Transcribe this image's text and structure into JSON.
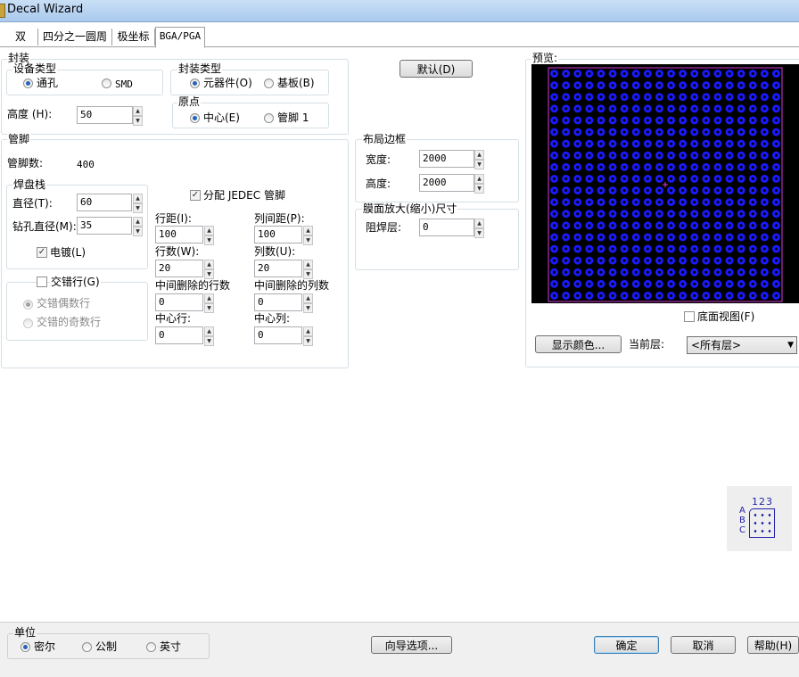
{
  "window": {
    "title": "Decal Wizard"
  },
  "tabs": [
    {
      "label": "双"
    },
    {
      "label": "四分之一圆周"
    },
    {
      "label": "极坐标"
    },
    {
      "label": "BGA/PGA",
      "active": true
    }
  ],
  "package": {
    "group_label": "封装",
    "device_type": {
      "label": "设备类型",
      "options": [
        "通孔",
        "SMD"
      ],
      "selected": "通孔"
    },
    "package_type": {
      "label": "封装类型",
      "options": [
        "元器件(O)",
        "基板(B)"
      ],
      "selected": "元器件(O)"
    },
    "height": {
      "label": "高度 (H):",
      "value": "50"
    },
    "origin": {
      "label": "原点",
      "options": [
        "中心(E)",
        "管脚 1"
      ],
      "selected": "中心(E)"
    },
    "default_button": "默认(D)"
  },
  "pins": {
    "group_label": "管脚",
    "count_label": "管脚数:",
    "count_value": "400",
    "padstack": {
      "label": "焊盘栈",
      "diameter_label": "直径(T):",
      "diameter_value": "60",
      "drill_label": "钻孔直径(M):",
      "drill_value": "35",
      "plated_label": "电镀(L)",
      "plated_checked": true
    },
    "staggered": {
      "label": "交错行(G)",
      "checked": false,
      "options": [
        "交错偶数行",
        "交错的奇数行"
      ],
      "selected": "交错偶数行"
    },
    "jedec": {
      "label": "分配 JEDEC 管脚",
      "checked": true
    },
    "row_pitch": {
      "label": "行距(I):",
      "value": "100"
    },
    "col_pitch": {
      "label": "列间距(P):",
      "value": "100"
    },
    "rows": {
      "label": "行数(W):",
      "value": "20"
    },
    "cols": {
      "label": "列数(U):",
      "value": "20"
    },
    "deleted_rows": {
      "label": "中间删除的行数",
      "value": "0"
    },
    "deleted_cols": {
      "label": "中间删除的列数",
      "value": "0"
    },
    "center_row": {
      "label": "中心行:",
      "value": "0"
    },
    "center_col": {
      "label": "中心列:",
      "value": "0"
    }
  },
  "placement_outline": {
    "label": "布局边框",
    "width_label": "宽度:",
    "width_value": "2000",
    "height_label": "高度:",
    "height_value": "2000"
  },
  "mask": {
    "label": "膜面放大(缩小)尺寸",
    "solder_label": "阻焊层:",
    "solder_value": "0"
  },
  "preview": {
    "label": "预览:",
    "grid_rows": 20,
    "grid_cols": 20,
    "pad_color": "#1a1aff",
    "outline_color": "#d23cd2",
    "background": "#000000",
    "bottom_view_label": "底面视图(F)",
    "bottom_view_checked": false,
    "colors_button": "显示颜色...",
    "current_layer_label": "当前层:",
    "current_layer_value": "<所有层>"
  },
  "jedec_icon": {
    "cols_text": "123",
    "rows_text": [
      "A",
      "B",
      "C"
    ]
  },
  "units": {
    "label": "单位",
    "options": [
      "密尔",
      "公制",
      "英寸"
    ],
    "selected": "密尔"
  },
  "footer": {
    "wizard_options": "向导选项...",
    "ok": "确定",
    "cancel": "取消",
    "help": "帮助(H)"
  }
}
